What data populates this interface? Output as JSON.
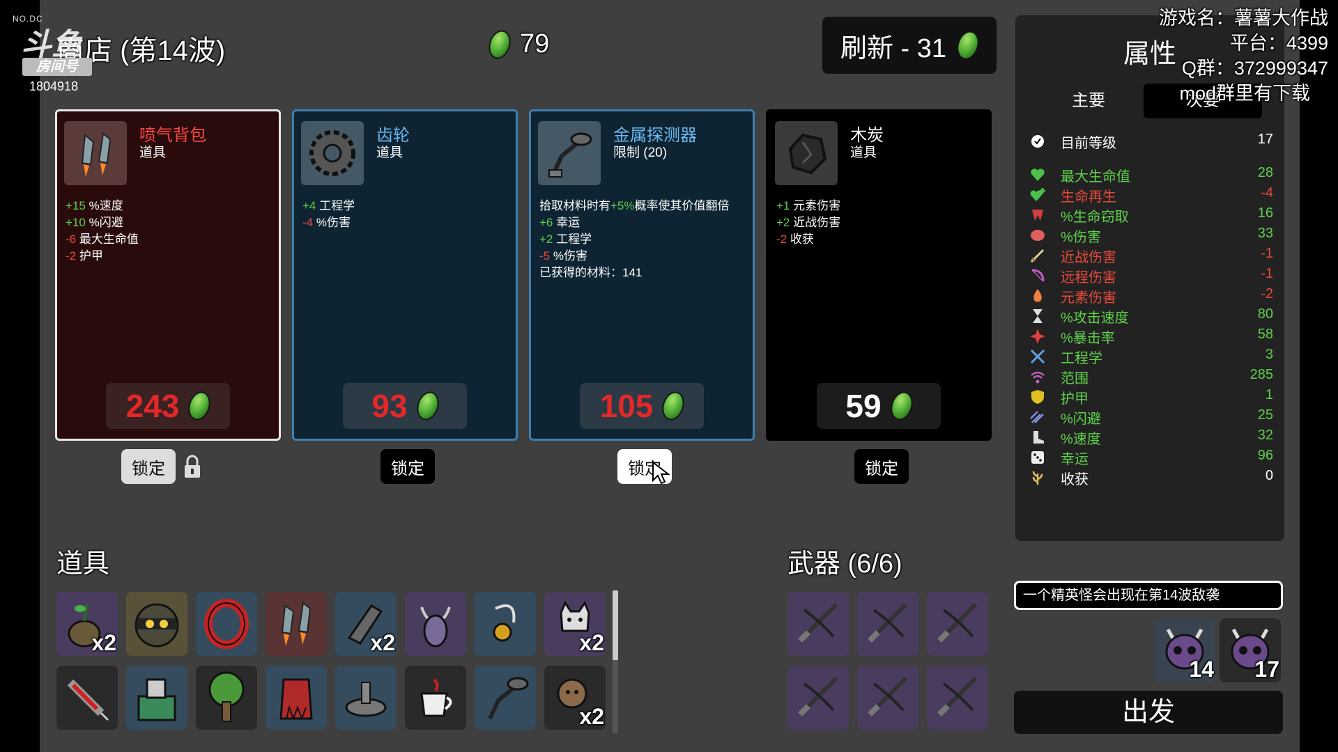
{
  "overlay": {
    "logo_text": "斗鱼",
    "logo_tag": "NO.DC",
    "room_label": "房间号",
    "room_number": "1804918",
    "game_name": "游戏名：薯薯大作战",
    "platform": "平台：4399",
    "qq_group": "Q群：372999347",
    "mod_note": "mod群里有下载"
  },
  "header": {
    "shop_title": "商店 (第14波)",
    "materials": "79",
    "reroll_label": "刷新 - 31"
  },
  "colors": {
    "positive": "#5fd14b",
    "negative": "#e84a3a",
    "price": "#e22828",
    "card_red": "#2a0b0b",
    "card_blue": "#0e2433",
    "card_black": "#000000"
  },
  "shop_items": [
    {
      "name": "喷气背包",
      "type": "道具",
      "icon": "jetpack-icon",
      "price": "243",
      "lock_label": "锁定",
      "stats": [
        {
          "value": "+15",
          "label": "%速度"
        },
        {
          "value": "+10",
          "label": "%闪避"
        },
        {
          "value": "-6",
          "label": "最大生命值"
        },
        {
          "value": "-2",
          "label": "护甲"
        }
      ]
    },
    {
      "name": "齿轮",
      "type": "道具",
      "icon": "gear-icon",
      "price": "93",
      "lock_label": "锁定",
      "stats": [
        {
          "value": "+4",
          "label": "工程学"
        },
        {
          "value": "-4",
          "label": "%伤害"
        }
      ]
    },
    {
      "name": "金属探测器",
      "type": "限制 (20)",
      "icon": "metal-detector-icon",
      "price": "105",
      "lock_label": "锁定",
      "desc_prefix": "拾取材料时有",
      "desc_value": "+5%",
      "desc_suffix": "概率使其价值翻倍",
      "stats": [
        {
          "value": "+6",
          "label": "幸运"
        },
        {
          "value": "+2",
          "label": "工程学"
        },
        {
          "value": "-5",
          "label": "%伤害"
        }
      ],
      "collected": "已获得的材料：141"
    },
    {
      "name": "木炭",
      "type": "道具",
      "icon": "charcoal-icon",
      "price": "59",
      "lock_label": "锁定",
      "stats": [
        {
          "value": "+1",
          "label": "元素伤害"
        },
        {
          "value": "+2",
          "label": "近战伤害"
        },
        {
          "value": "-2",
          "label": "收获"
        }
      ]
    }
  ],
  "items_section": {
    "title": "道具",
    "row1": [
      {
        "icon": "potion-plant-icon",
        "qty": "x2"
      },
      {
        "icon": "ninja-head-icon",
        "qty": ""
      },
      {
        "icon": "red-ring-icon",
        "qty": ""
      },
      {
        "icon": "jetpack-icon",
        "qty": ""
      },
      {
        "icon": "stone-icon",
        "qty": "x2"
      },
      {
        "icon": "horned-beast-icon",
        "qty": ""
      },
      {
        "icon": "amulet-icon",
        "qty": ""
      },
      {
        "icon": "cat-icon",
        "qty": "x2"
      }
    ],
    "row2": [
      {
        "icon": "syringe-icon",
        "qty": ""
      },
      {
        "icon": "machine-icon",
        "qty": ""
      },
      {
        "icon": "tree-icon",
        "qty": ""
      },
      {
        "icon": "red-cape-icon",
        "qty": ""
      },
      {
        "icon": "altar-icon",
        "qty": ""
      },
      {
        "icon": "coffee-icon",
        "qty": ""
      },
      {
        "icon": "metal-detector-icon",
        "qty": ""
      },
      {
        "icon": "monkey-icon",
        "qty": "x2"
      }
    ]
  },
  "weapons_section": {
    "title": "武器 (6/6)",
    "weapons": [
      "crossbow-icon",
      "crossbow-icon",
      "crossbow-icon",
      "crossbow-icon",
      "crossbow-icon",
      "crossbow-icon"
    ]
  },
  "attributes": {
    "title": "属性",
    "tab_primary": "主要",
    "tab_secondary": "次要",
    "level_label": "目前等级",
    "level_value": "17",
    "stats": [
      {
        "label": "最大生命值",
        "value": "28",
        "color": "#5fd14b",
        "icon": "heart-icon"
      },
      {
        "label": "生命再生",
        "value": "-4",
        "color": "#e84a3a",
        "icon": "heart-plus-icon"
      },
      {
        "label": "%生命窃取",
        "value": "16",
        "color": "#5fd14b",
        "icon": "fang-icon"
      },
      {
        "label": "%伤害",
        "value": "33",
        "color": "#5fd14b",
        "icon": "muscle-icon"
      },
      {
        "label": "近战伤害",
        "value": "-1",
        "color": "#e84a3a",
        "icon": "sword-icon"
      },
      {
        "label": "远程伤害",
        "value": "-1",
        "color": "#e84a3a",
        "icon": "bow-icon"
      },
      {
        "label": "元素伤害",
        "value": "-2",
        "color": "#e84a3a",
        "icon": "flame-icon"
      },
      {
        "label": "%攻击速度",
        "value": "80",
        "color": "#5fd14b",
        "icon": "hourglass-icon"
      },
      {
        "label": "%暴击率",
        "value": "58",
        "color": "#5fd14b",
        "icon": "crit-icon"
      },
      {
        "label": "工程学",
        "value": "3",
        "color": "#5fd14b",
        "icon": "wrench-icon"
      },
      {
        "label": "范围",
        "value": "285",
        "color": "#5fd14b",
        "icon": "range-icon"
      },
      {
        "label": "护甲",
        "value": "1",
        "color": "#5fd14b",
        "icon": "shield-icon"
      },
      {
        "label": "%闪避",
        "value": "25",
        "color": "#5fd14b",
        "icon": "dodge-icon"
      },
      {
        "label": "%速度",
        "value": "32",
        "color": "#5fd14b",
        "icon": "boot-icon"
      },
      {
        "label": "幸运",
        "value": "96",
        "color": "#5fd14b",
        "icon": "dice-icon"
      },
      {
        "label": "收获",
        "value": "0",
        "color": "#ffffff",
        "icon": "wheat-icon"
      }
    ]
  },
  "elite_notice": "一个精英怪会出现在第14波敌袭",
  "elite_waves": [
    "14",
    "17"
  ],
  "go_button": "出发"
}
